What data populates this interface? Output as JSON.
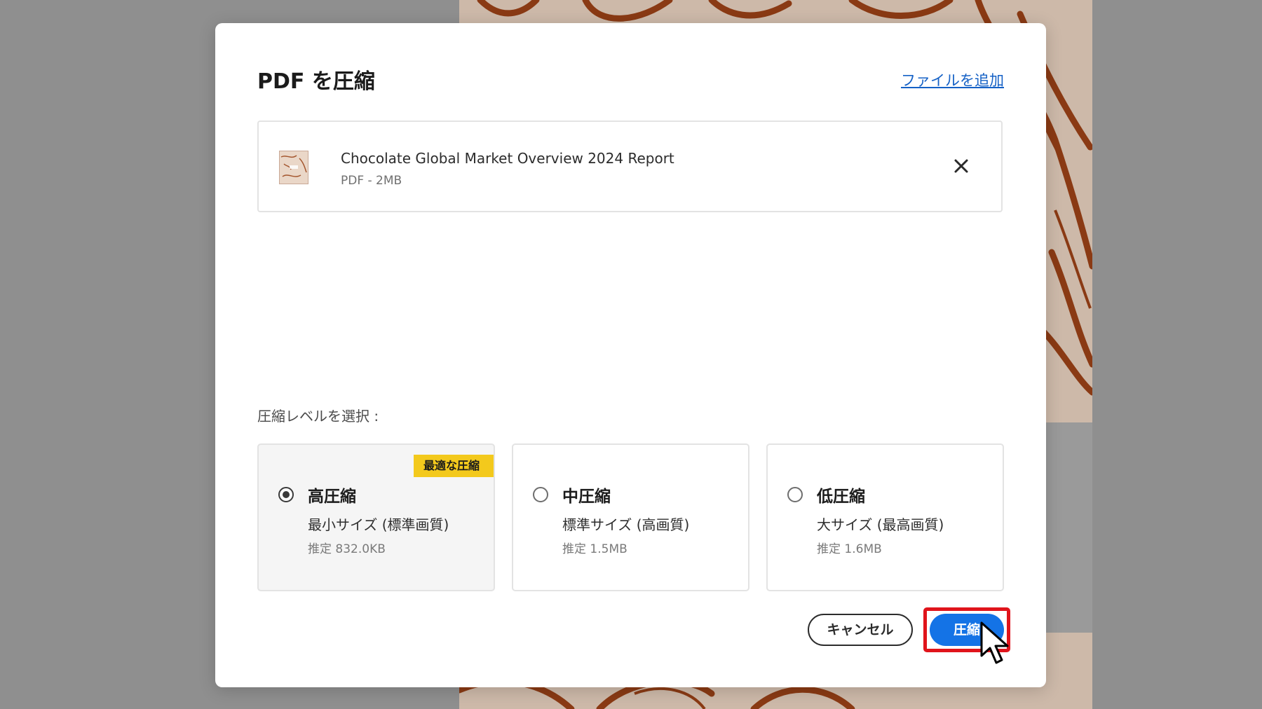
{
  "dialog": {
    "title": "PDF を圧縮",
    "add_file_link": "ファイルを追加"
  },
  "file": {
    "name": "Chocolate Global Market Overview 2024 Report",
    "meta": "PDF - 2MB",
    "thumbnail_icon": "pdf-thumbnail-icon",
    "remove_icon": "close-icon"
  },
  "compression": {
    "label": "圧縮レベルを選択 :",
    "selected_index": 0,
    "options": [
      {
        "badge": "最適な圧縮",
        "title": "高圧縮",
        "description": "最小サイズ (標準画質)",
        "estimate": "推定 832.0KB",
        "checked": true
      },
      {
        "title": "中圧縮",
        "description": "標準サイズ (高画質)",
        "estimate": "推定 1.5MB",
        "checked": false
      },
      {
        "title": "低圧縮",
        "description": "大サイズ (最高画質)",
        "estimate": "推定 1.6MB",
        "checked": false
      }
    ]
  },
  "actions": {
    "cancel_label": "キャンセル",
    "compress_label": "圧縮"
  },
  "colors": {
    "primary": "#1473e6",
    "badge": "#f3c91c",
    "highlight": "#e0141b",
    "link": "#1561c6"
  }
}
